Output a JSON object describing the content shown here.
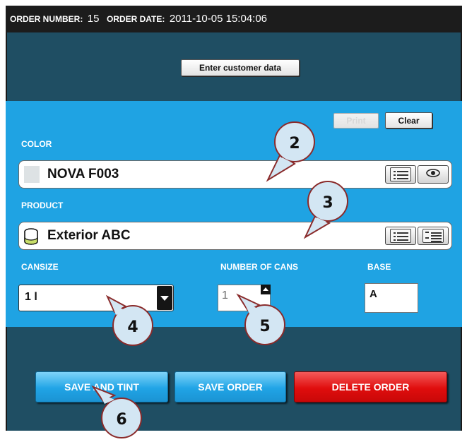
{
  "header": {
    "order_number_label": "ORDER NUMBER:",
    "order_number": "15",
    "order_date_label": "ORDER DATE:",
    "order_date": "2011-10-05 15:04:06"
  },
  "customer": {
    "enter_button": "Enter customer data"
  },
  "actions": {
    "print": "Print",
    "clear": "Clear"
  },
  "color": {
    "label": "COLOR",
    "value": "NOVA F003"
  },
  "product": {
    "label": "PRODUCT",
    "value": "Exterior ABC"
  },
  "cansize": {
    "label": "CANSIZE",
    "value": "1 l"
  },
  "cans": {
    "label": "NUMBER OF CANS",
    "value": "1"
  },
  "base": {
    "label": "BASE",
    "value": "A"
  },
  "footer": {
    "save_and_tint": "SAVE AND TINT",
    "save_order": "SAVE ORDER",
    "delete_order": "DELETE ORDER"
  },
  "callouts": {
    "c2": "2",
    "c3": "3",
    "c4": "4",
    "c5": "5",
    "c6": "6"
  },
  "colors": {
    "header_bg": "#1c1c1c",
    "panel_dark": "#1f4e63",
    "panel_light": "#1fa3e3",
    "save_button": "#20a4e6",
    "delete_button": "#e00d0d",
    "callout_fill": "#d3e6f3"
  },
  "icons": {
    "list": "list-icon",
    "eye": "eye-icon",
    "can": "paint-can-icon",
    "dropdown": "chevron-down-icon",
    "spinner": "spinner-up-icon"
  }
}
